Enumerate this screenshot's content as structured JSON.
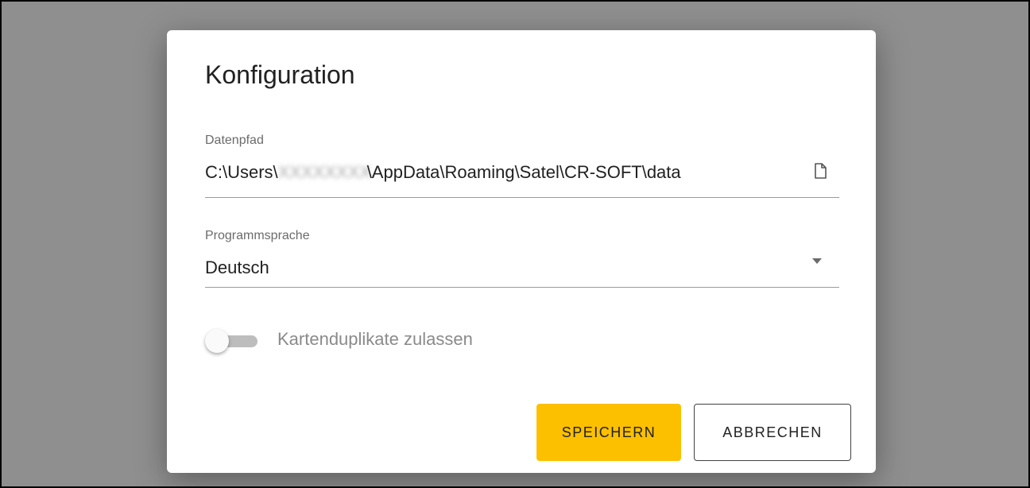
{
  "dialog": {
    "title": "Konfiguration",
    "data_path": {
      "label": "Datenpfad",
      "value_prefix": "C:\\Users\\",
      "value_suffix": "\\AppData\\Roaming\\Satel\\CR-SOFT\\data",
      "icon": "file-icon"
    },
    "language": {
      "label": "Programmsprache",
      "selected": "Deutsch",
      "icon": "dropdown-arrow-icon"
    },
    "duplicates_toggle": {
      "label": "Kartenduplikate zulassen",
      "enabled": false
    },
    "buttons": {
      "save_label": "SPEICHERN",
      "cancel_label": "ABBRECHEN"
    }
  },
  "colors": {
    "overlay": "#8f8f8f",
    "dialog_background": "#ffffff",
    "save_button": "#fcc000",
    "toggle_track": "#bdbdbd"
  }
}
